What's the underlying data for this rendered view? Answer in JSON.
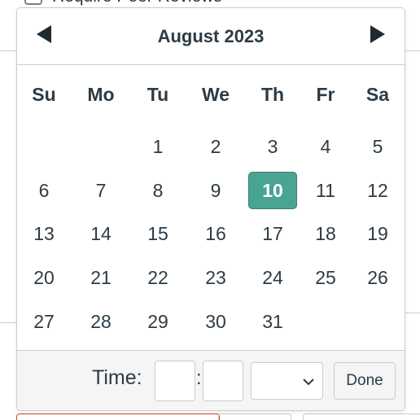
{
  "background": {
    "checkbox_label": "Require Peer Reviews"
  },
  "datepicker": {
    "prev_icon": "triangle-left-icon",
    "next_icon": "triangle-right-icon",
    "month_title": "August 2023",
    "days_of_week": [
      "Su",
      "Mo",
      "Tu",
      "We",
      "Th",
      "Fr",
      "Sa"
    ],
    "weeks": [
      [
        "",
        "",
        "1",
        "2",
        "3",
        "4",
        "5"
      ],
      [
        "6",
        "7",
        "8",
        "9",
        "10",
        "11",
        "12"
      ],
      [
        "13",
        "14",
        "15",
        "16",
        "17",
        "18",
        "19"
      ],
      [
        "20",
        "21",
        "22",
        "23",
        "24",
        "25",
        "26"
      ],
      [
        "27",
        "28",
        "29",
        "30",
        "31",
        "",
        ""
      ]
    ],
    "selected_day": "10",
    "time_label": "Time:",
    "time_separator": ":",
    "hour_value": "",
    "minute_value": "",
    "ampm_value": "",
    "ampm_icon": "chevron-down-icon",
    "done_label": "Done"
  },
  "colors": {
    "selected_bg": "#4aa494",
    "text": "#2d3b45",
    "border": "#c7cdd1",
    "footer_bg": "#f5f5f5"
  }
}
